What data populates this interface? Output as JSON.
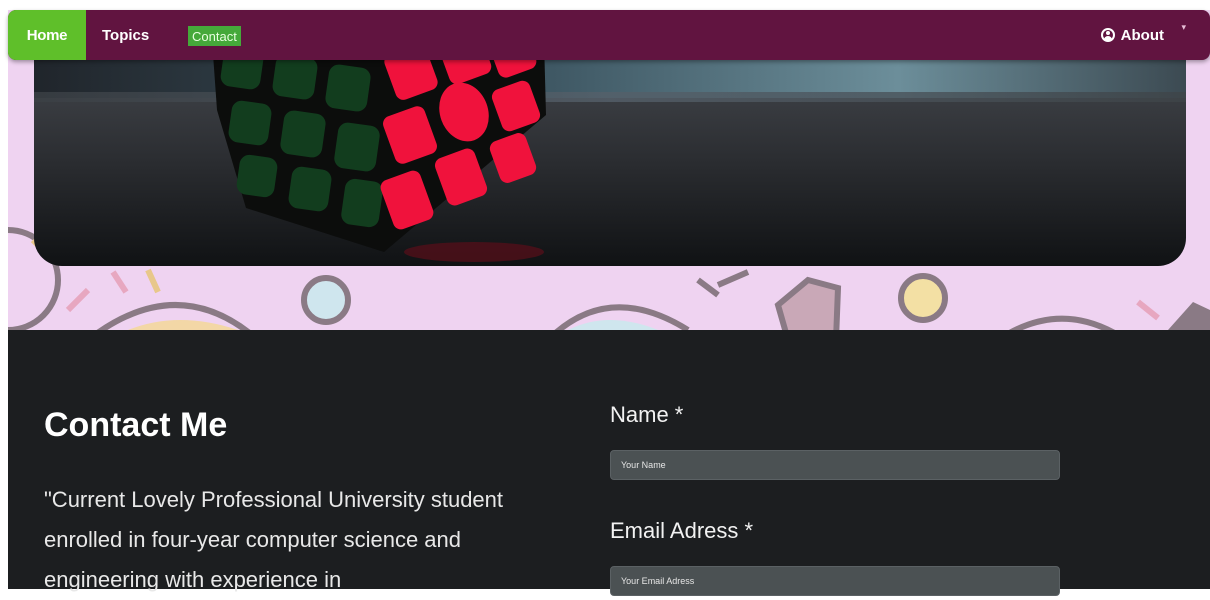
{
  "nav": {
    "home": "Home",
    "topics": "Topics",
    "contact": "Contact",
    "about": "About",
    "about_icon": "user-circle-icon",
    "caret_icon": "caret-down-icon",
    "bar_color": "#611440",
    "home_color": "#5fbf2a",
    "contact_color": "#45a93a"
  },
  "contact": {
    "title": "Contact Me",
    "bio": "\"Current Lovely Professional University student enrolled in four-year computer science and engineering with experience in",
    "name_label": "Name *",
    "name_placeholder": "Your Name",
    "email_label": "Email Adress *",
    "email_placeholder": "Your Email Adress",
    "bg_color": "#1c1e20"
  }
}
